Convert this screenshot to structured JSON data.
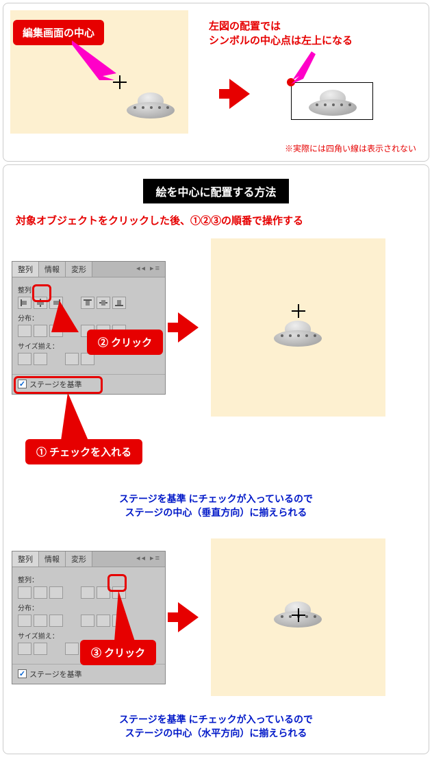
{
  "card1": {
    "badge": "編集画面の中心",
    "headline1": "左図の配置では",
    "headline2": "シンボルの中心点は左上になる",
    "note": "※実際には四角い線は表示されない"
  },
  "card2": {
    "title": "絵を中心に配置する方法",
    "instruction": "対象オブジェクトをクリックした後、①②③の順番で操作する",
    "panel": {
      "tabs": [
        "整列",
        "情報",
        "変形"
      ],
      "section_align": "整列：",
      "section_distribute": "分布：",
      "section_size": "サイズ揃え：",
      "checkbox": "ステージを基準"
    },
    "callout1": "①  チェックを入れる",
    "callout2": "②  クリック",
    "callout3": "③  クリック",
    "caption1a": "ステージを基準 にチェックが入っているので",
    "caption1b": "ステージの中心（垂直方向）に揃えられる",
    "caption2a": "ステージを基準 にチェックが入っているので",
    "caption2b": "ステージの中心（水平方向）に揃えられる"
  }
}
